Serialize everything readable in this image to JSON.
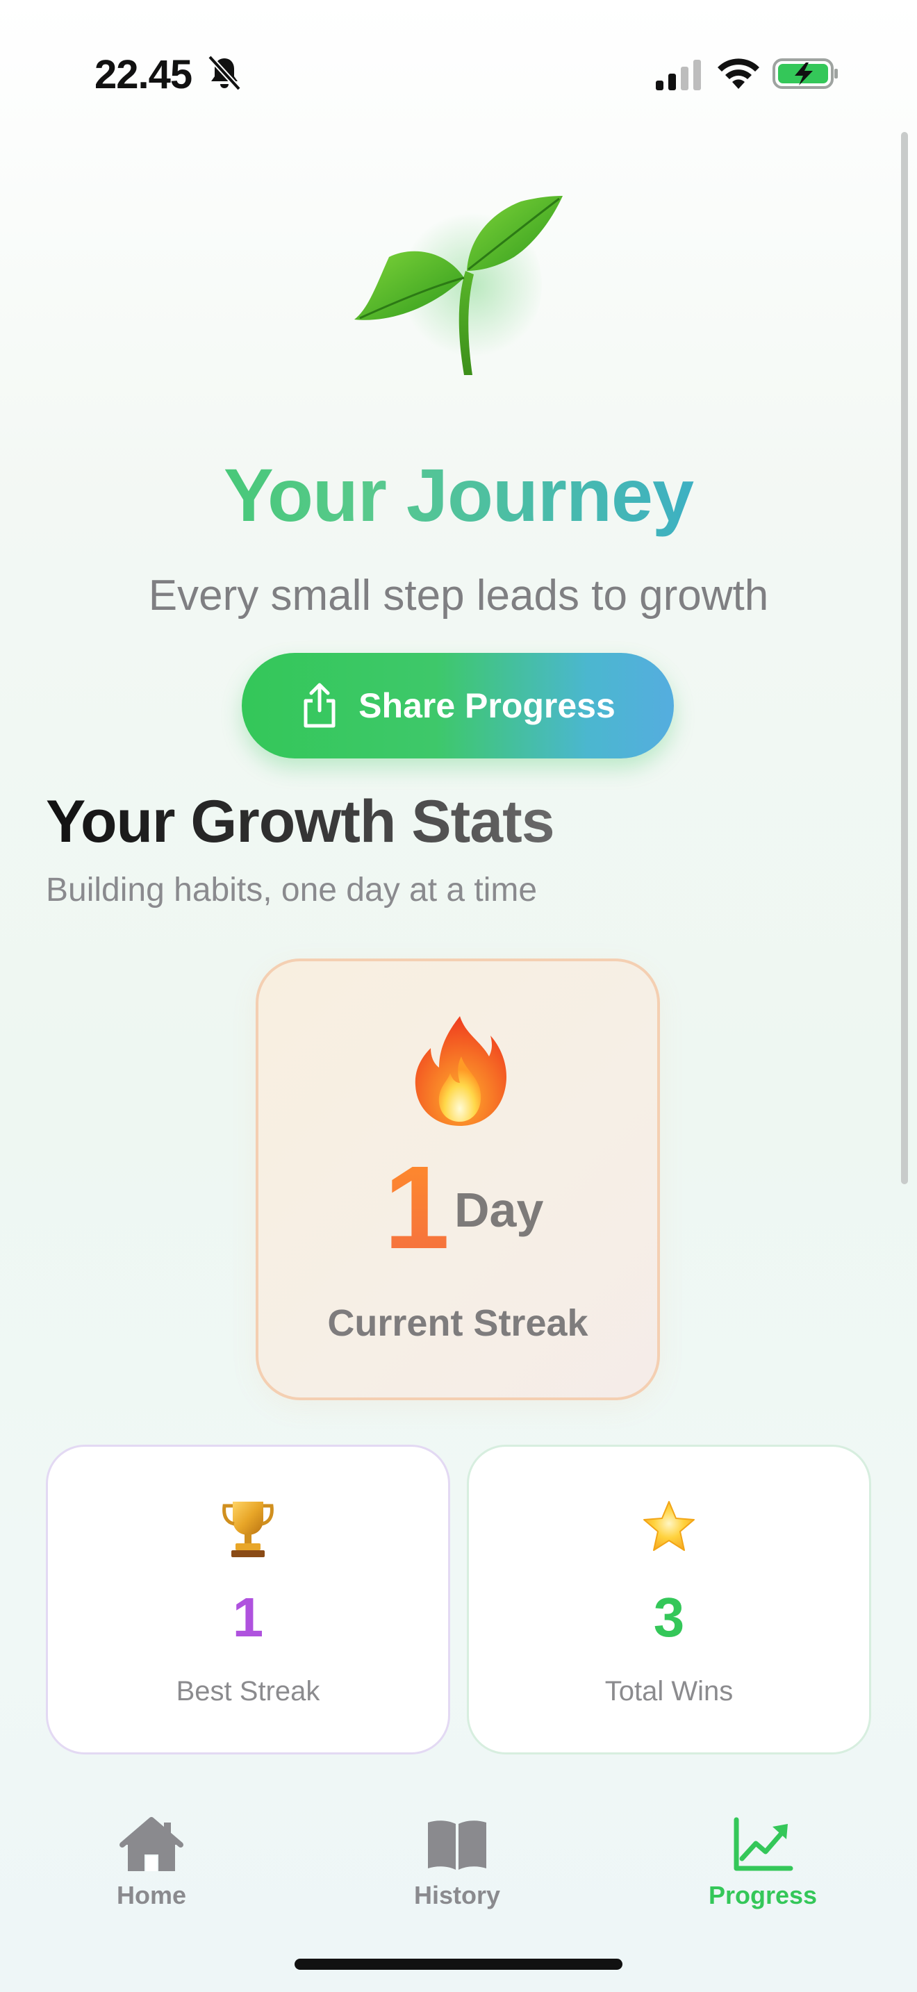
{
  "status_bar": {
    "time": "22.45",
    "icons": [
      "bell-slash-icon",
      "cellular-signal-icon",
      "wifi-icon",
      "battery-charging-icon"
    ]
  },
  "header": {
    "hero_icon": "seedling-icon",
    "title": "Your Journey",
    "subtitle": "Every small step leads to growth",
    "share_button": {
      "label": "Share Progress",
      "icon": "share-icon"
    }
  },
  "stats": {
    "title": "Your Growth Stats",
    "subtitle": "Building habits, one day at a time",
    "current_streak": {
      "icon": "fire-icon",
      "value": "1",
      "unit": "Day",
      "label": "Current Streak"
    },
    "best_streak": {
      "icon": "trophy-icon",
      "value": "1",
      "label": "Best Streak"
    },
    "total_wins": {
      "icon": "star-icon",
      "value": "3",
      "label": "Total Wins"
    }
  },
  "tab_bar": {
    "tabs": [
      {
        "label": "Home",
        "icon": "house-icon",
        "active": false
      },
      {
        "label": "History",
        "icon": "book-icon",
        "active": false
      },
      {
        "label": "Progress",
        "icon": "chart-trend-icon",
        "active": true
      }
    ]
  },
  "colors": {
    "accent_green": "#34c759",
    "accent_blue": "#2b9fe8",
    "streak_orange": "#ff8c2b",
    "best_purple": "#af52de",
    "wins_green": "#34c759",
    "inactive_gray": "#8a8a8e"
  }
}
